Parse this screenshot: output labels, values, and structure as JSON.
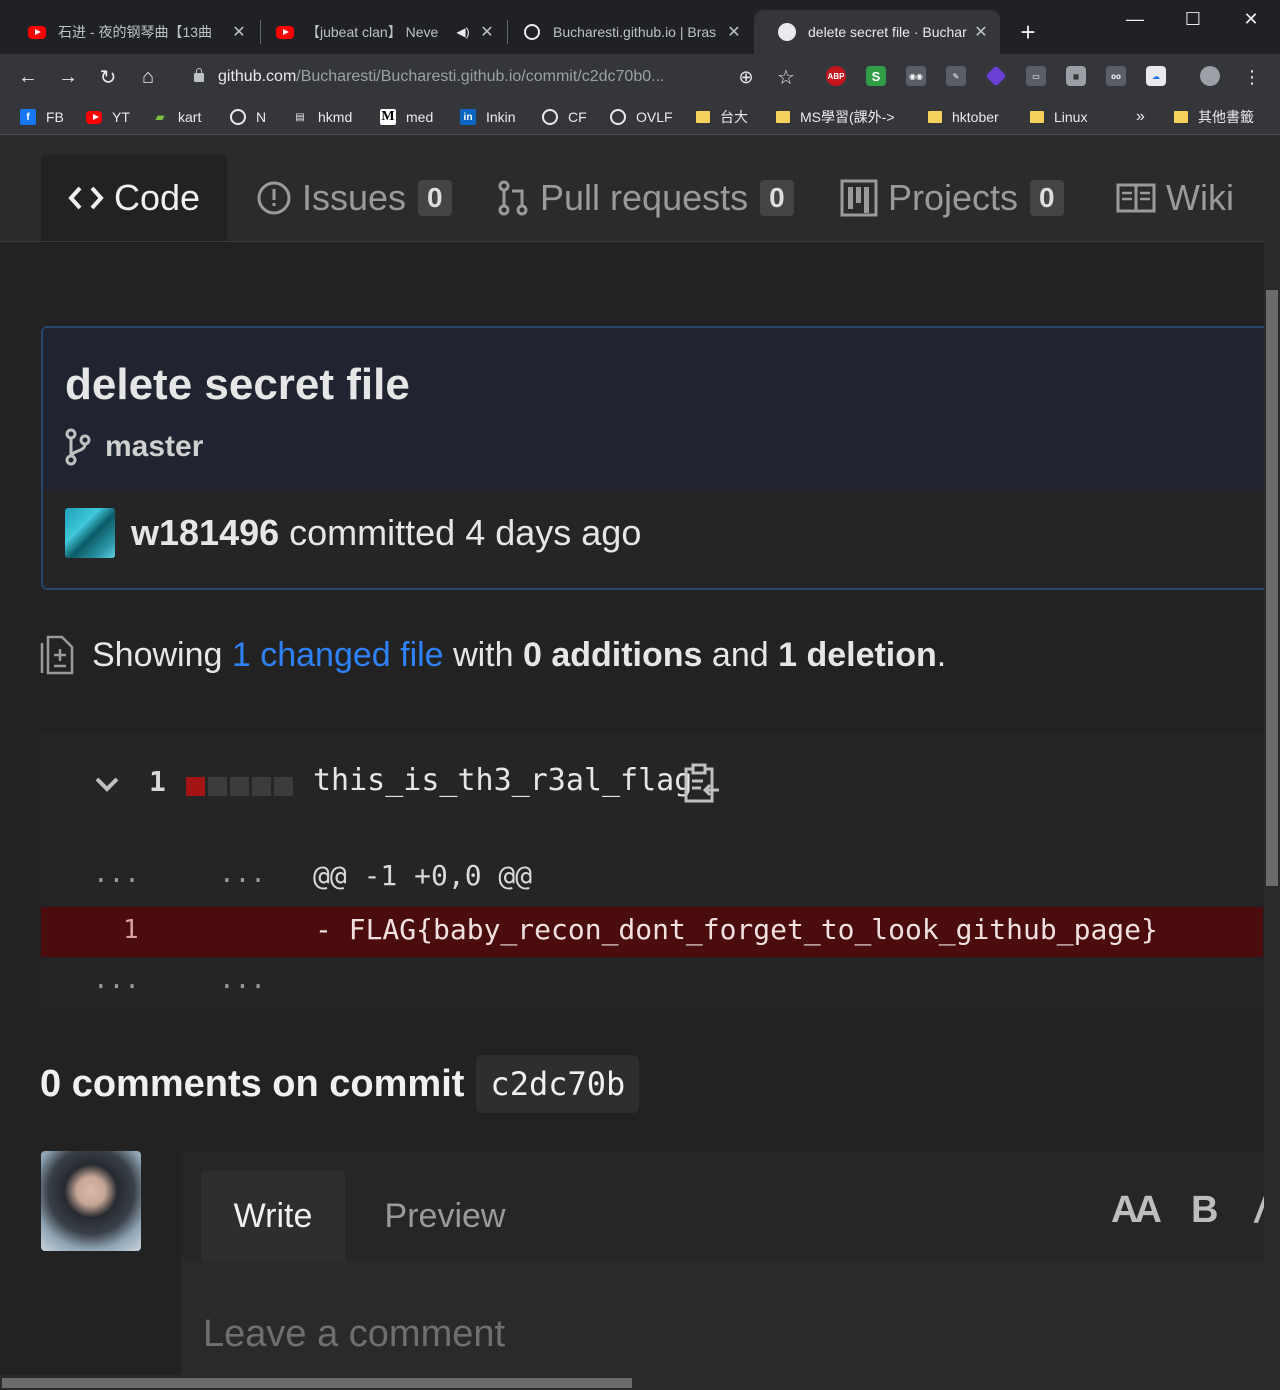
{
  "browser": {
    "tabs": [
      {
        "title": "石进 - 夜的钢琴曲【13曲"
      },
      {
        "title": "【jubeat clan】 Neve"
      },
      {
        "title": "Bucharesti.github.io | Bras"
      },
      {
        "title": "delete secret file · Buchar"
      }
    ],
    "url_host": "github.com",
    "url_path": "/Bucharesti/Bucharesti.github.io/commit/c2dc70b0...",
    "extensions": [
      "ABP",
      "S"
    ],
    "bookmarks": [
      "FB",
      "YT",
      "kart",
      "N",
      "hkmd",
      "med",
      "Inkin",
      "CF",
      "OVLF",
      "台大",
      "MS學習(課外->",
      "hktober",
      "Linux"
    ],
    "bookmarks_overflow": "»",
    "other_bookmarks": "其他書籤"
  },
  "reponav": {
    "code": "Code",
    "issues": "Issues",
    "issues_count": "0",
    "pulls": "Pull requests",
    "pulls_count": "0",
    "projects": "Projects",
    "projects_count": "0",
    "wiki": "Wiki"
  },
  "commit": {
    "title": "delete secret file",
    "branch": "master",
    "author": "w181496",
    "committed_text": "committed 4 days ago"
  },
  "summary": {
    "prefix": "Showing",
    "changed": "1 changed file",
    "with": "with",
    "additions": "0 additions",
    "and": "and",
    "deletions": "1 deletion",
    "period": "."
  },
  "diff": {
    "count": "1",
    "file_name": "this_is_th3_r3al_flag",
    "stat_colors": [
      "#a31515",
      "#3c3c3c",
      "#3c3c3c",
      "#3c3c3c",
      "#3c3c3c"
    ],
    "ellipsis": "...",
    "hunk_header": "@@ -1 +0,0 @@",
    "deleted_line_number": "1",
    "deleted_line": "- FLAG{baby_recon_dont_forget_to_look_github_page}"
  },
  "comments": {
    "heading": "0 comments on commit",
    "sha": "c2dc70b",
    "write_tab": "Write",
    "preview_tab": "Preview",
    "format_text_size": "AA",
    "format_bold": "B",
    "placeholder": "Leave a comment"
  }
}
